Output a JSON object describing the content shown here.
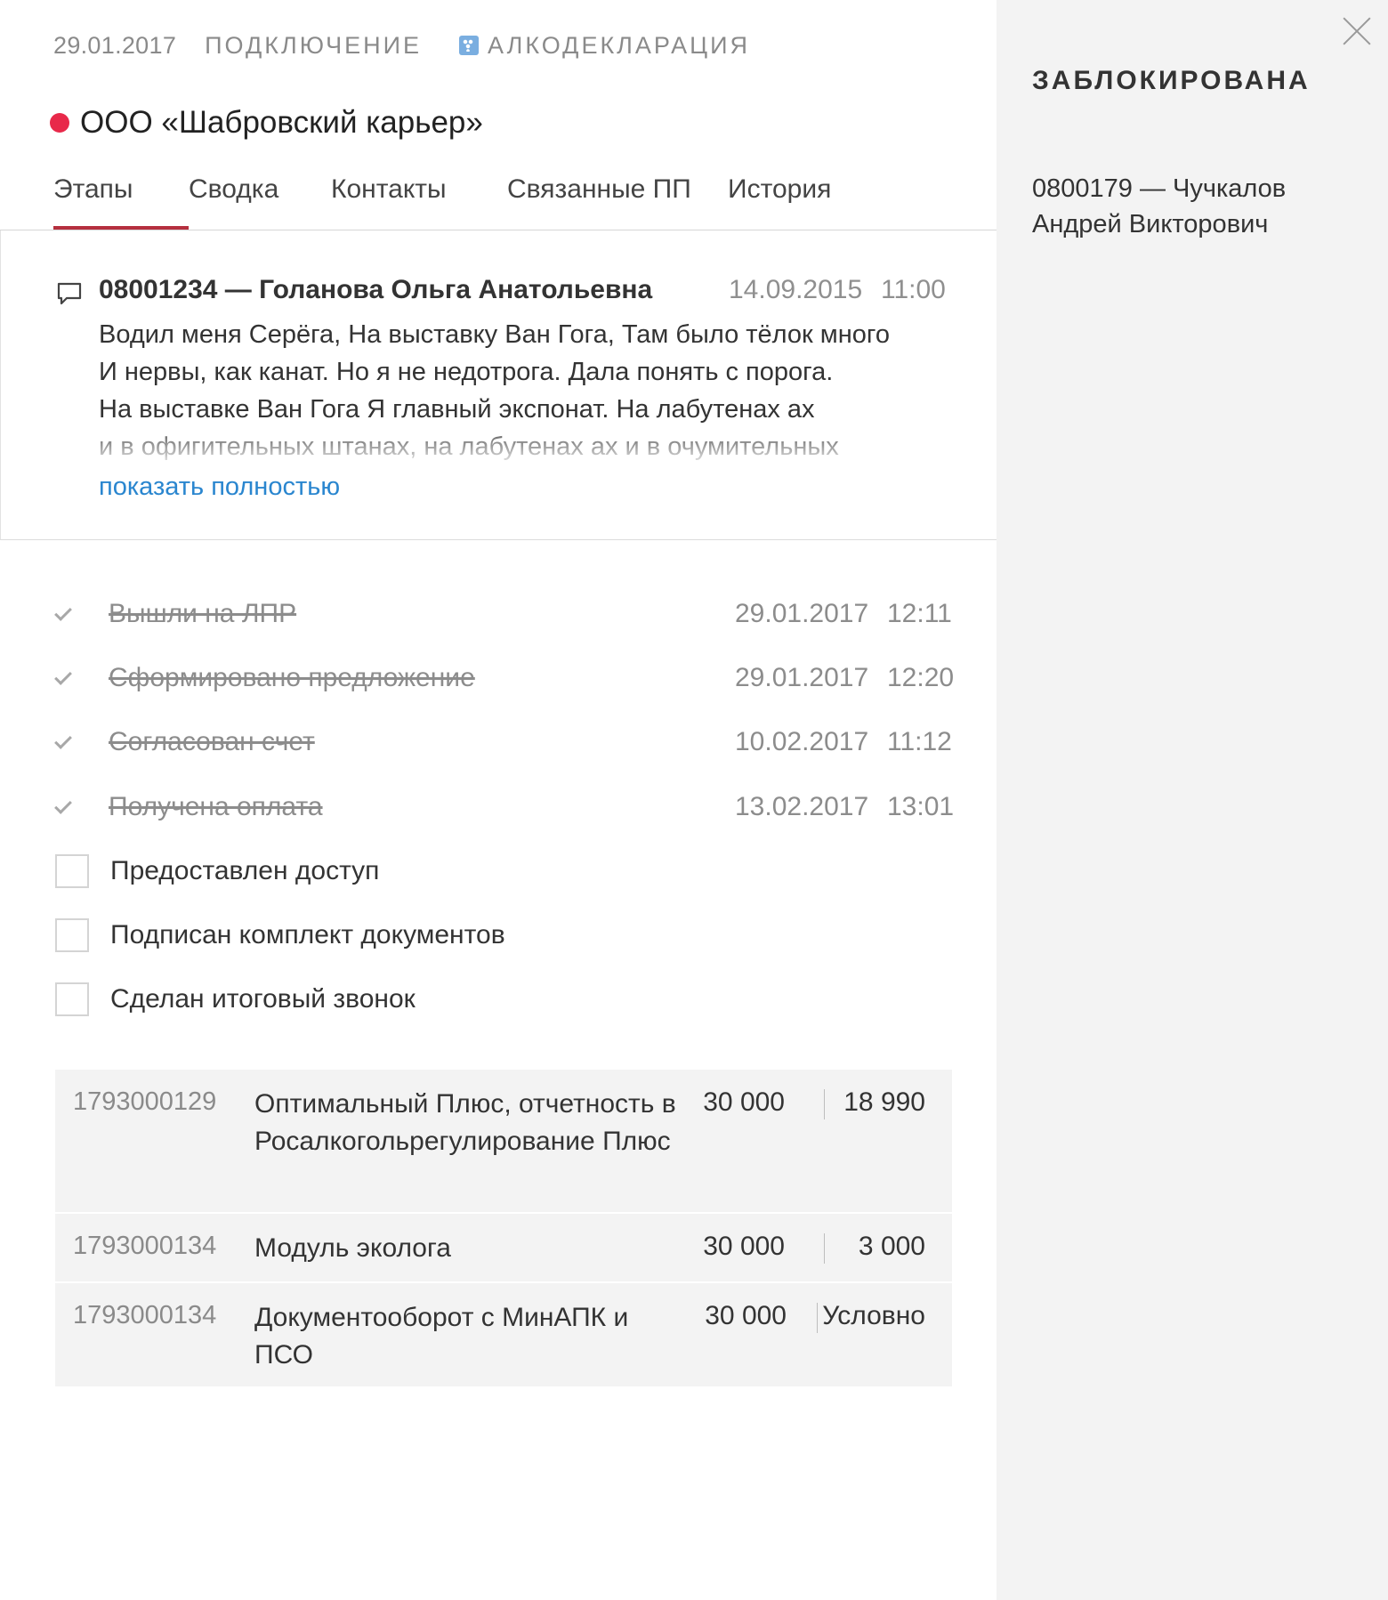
{
  "header": {
    "date": "29.01.2017",
    "category": "ПОДКЛЮЧЕНИЕ",
    "product": "АЛКОДЕКЛАРАЦИЯ",
    "product_icon": "grapes-icon",
    "company": "ООО «Шабровский карьер»",
    "status_color": "#e8294a"
  },
  "tabs": [
    {
      "label": "Этапы",
      "active": true
    },
    {
      "label": "Сводка",
      "active": false
    },
    {
      "label": "Контакты",
      "active": false
    },
    {
      "label": "Связанные ПП",
      "active": false
    },
    {
      "label": "История",
      "active": false
    }
  ],
  "comment": {
    "icon": "comment-icon",
    "author": "08001234 — Голанова Ольга Анатольевна",
    "date": "14.09.2015",
    "time": "11:00",
    "lines": [
      "Водил меня Серёга, На выставку Ван Гога, Там было тёлок много",
      "И нервы, как канат. Но я не недотрога. Дала понять с порога.",
      "На выставке Ван Гога Я главный экспонат. На лабутенах ах",
      "и в офигительных штанах, на лабутенах ах и в очумительных"
    ],
    "show_more": "показать полностью"
  },
  "stages_done": [
    {
      "label": "Вышли на ЛПР",
      "date": "29.01.2017",
      "time": "12:11"
    },
    {
      "label": "Сформировано предложение",
      "date": "29.01.2017",
      "time": "12:20"
    },
    {
      "label": "Согласован счет",
      "date": "10.02.2017",
      "time": "11:12"
    },
    {
      "label": "Получена оплата",
      "date": "13.02.2017",
      "time": "13:01"
    }
  ],
  "stages_todo": [
    {
      "label": "Предоставлен доступ",
      "checked": false
    },
    {
      "label": "Подписан комплект документов",
      "checked": false
    },
    {
      "label": "Сделан итоговый звонок",
      "checked": false
    }
  ],
  "products": [
    {
      "code": "1793000129",
      "name": "Оптимальный Плюс, отчетность в Росалкогольрегулирование Плюс",
      "price": "30 000",
      "value": "18 990"
    },
    {
      "code": "1793000134",
      "name": "Модуль эколога",
      "price": "30 000",
      "value": "3 000"
    },
    {
      "code": "1793000134",
      "name": "Документооборот с МинАПК и ПСО",
      "price": "30 000",
      "value": "Условно"
    }
  ],
  "sidebar": {
    "status": "ЗАБЛОКИРОВАНА",
    "manager": "0800179 — Чучкалов Андрей Викторович",
    "close_icon": "close-icon"
  },
  "colors": {
    "accent_tab": "#b5303f",
    "link": "#2a86cf",
    "sidebar_bg": "#f3f3f3"
  }
}
